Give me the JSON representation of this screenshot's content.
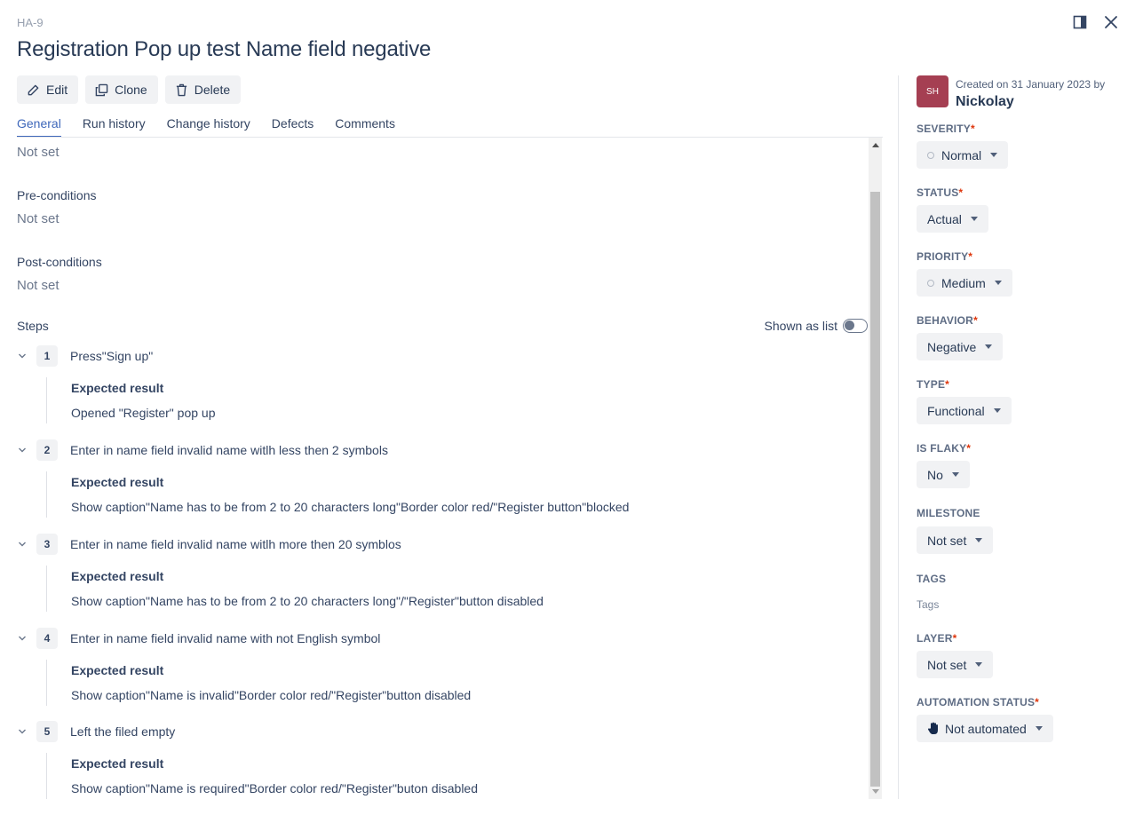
{
  "header": {
    "case_key": "HA-9",
    "title": "Registration Pop up test Name field negative"
  },
  "actions": {
    "edit": "Edit",
    "clone": "Clone",
    "delete": "Delete"
  },
  "tabs": [
    {
      "label": "General",
      "active": true
    },
    {
      "label": "Run history",
      "active": false
    },
    {
      "label": "Change history",
      "active": false
    },
    {
      "label": "Defects",
      "active": false
    },
    {
      "label": "Comments",
      "active": false
    }
  ],
  "general": {
    "top_value": "Not set",
    "preconditions": {
      "label": "Pre-conditions",
      "value": "Not set"
    },
    "postconditions": {
      "label": "Post-conditions",
      "value": "Not set"
    },
    "steps_label": "Steps",
    "shown_as_list": "Shown as list",
    "expected_result_label": "Expected result",
    "steps": [
      {
        "num": "1",
        "action": "Press\"Sign up\"",
        "expected": "Opened \"Register\" pop up"
      },
      {
        "num": "2",
        "action": "Enter in name field invalid name witlh less then 2 symbols",
        "expected": "Show caption\"Name has to be from 2 to 20 characters long\"Border color red/\"Register button\"blocked"
      },
      {
        "num": "3",
        "action": "Enter in name field invalid name witlh more then 20 symblos",
        "expected": "Show caption\"Name has to be from 2 to 20 characters long\"/\"Register\"button disabled"
      },
      {
        "num": "4",
        "action": "Enter in name field invalid name with not English symbol",
        "expected": "Show caption\"Name is invalid\"Border color red/\"Register\"button disabled"
      },
      {
        "num": "5",
        "action": "Left the filed empty",
        "expected": "Show caption\"Name is required\"Border color red/\"Register\"buton disabled"
      }
    ]
  },
  "sidebar": {
    "avatar_initials": "SH",
    "created_text": "Created on 31 January 2023 by",
    "created_by": "Nickolay",
    "severity": {
      "label": "SEVERITY",
      "value": "Normal"
    },
    "status": {
      "label": "STATUS",
      "value": "Actual"
    },
    "priority": {
      "label": "PRIORITY",
      "value": "Medium"
    },
    "behavior": {
      "label": "BEHAVIOR",
      "value": "Negative"
    },
    "type": {
      "label": "TYPE",
      "value": "Functional"
    },
    "is_flaky": {
      "label": "IS FLAKY",
      "value": "No"
    },
    "milestone": {
      "label": "MILESTONE",
      "value": "Not set"
    },
    "tags": {
      "label": "TAGS",
      "placeholder": "Tags"
    },
    "layer": {
      "label": "LAYER",
      "value": "Not set"
    },
    "automation_status": {
      "label": "AUTOMATION STATUS",
      "value": "Not automated"
    },
    "required_mark": "*"
  },
  "colors": {
    "accent": "#3e67ba",
    "avatar_bg": "#a53f52",
    "required": "#de350b",
    "button_bg": "#f1f2f4"
  },
  "icons": {
    "edit": "pencil-icon",
    "clone": "copy-icon",
    "delete": "trash-icon",
    "panel": "side-panel-icon",
    "close": "close-icon",
    "chevron": "chevron-down-icon",
    "automation": "hand-icon"
  }
}
